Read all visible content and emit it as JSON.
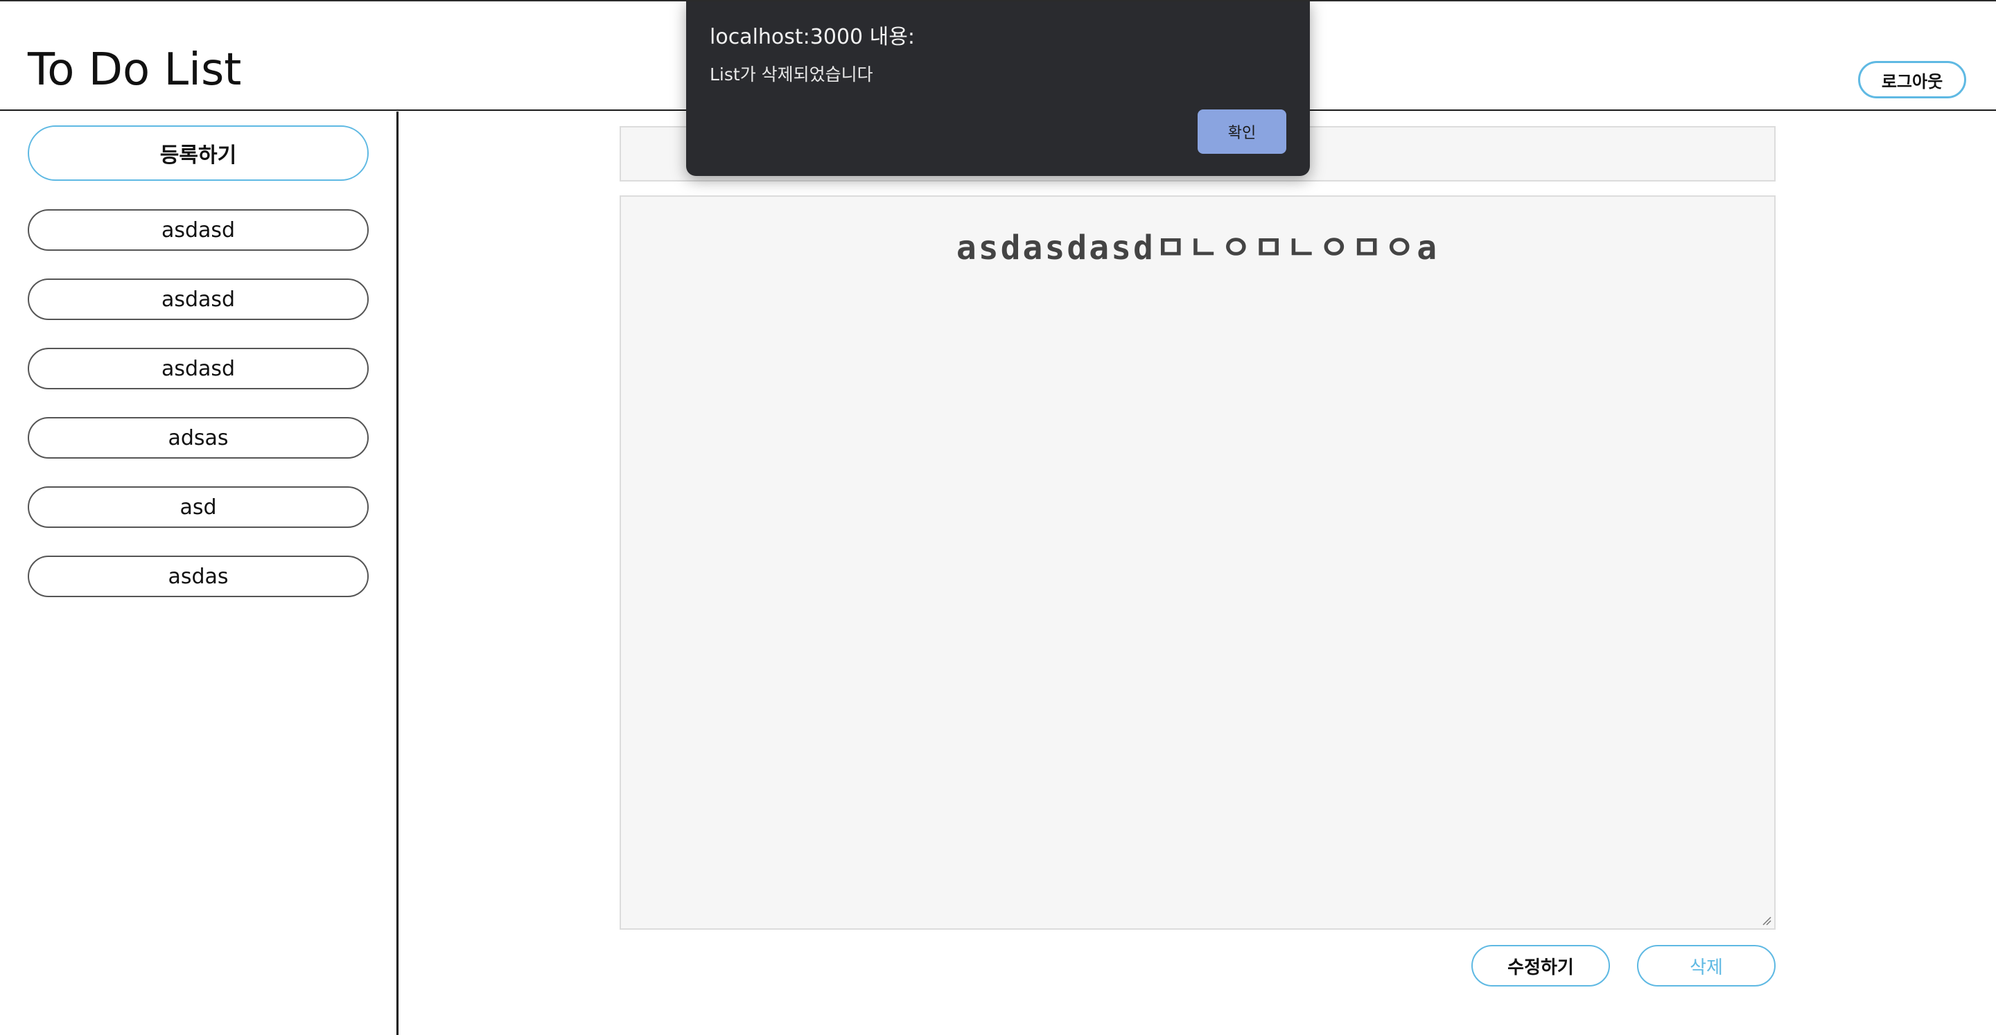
{
  "header": {
    "title": "To Do List",
    "logout_label": "로그아웃"
  },
  "sidebar": {
    "register_label": "등록하기",
    "items": [
      {
        "label": "asdasd"
      },
      {
        "label": "asdasd"
      },
      {
        "label": "asdasd"
      },
      {
        "label": "adsas"
      },
      {
        "label": "asd"
      },
      {
        "label": "asdas"
      }
    ]
  },
  "main": {
    "title_value": "",
    "content_value": "asdasdasdㅁㄴㅇㅁㄴㅇㅁㅇa",
    "edit_label": "수정하기",
    "delete_label": "삭제"
  },
  "alert": {
    "title": "localhost:3000 내용:",
    "message": "List가 삭제되었습니다",
    "ok_label": "확인"
  },
  "colors": {
    "accent": "#5fb9e3",
    "dialog_bg": "#2a2b2f",
    "dialog_button": "#8aa4e0"
  }
}
